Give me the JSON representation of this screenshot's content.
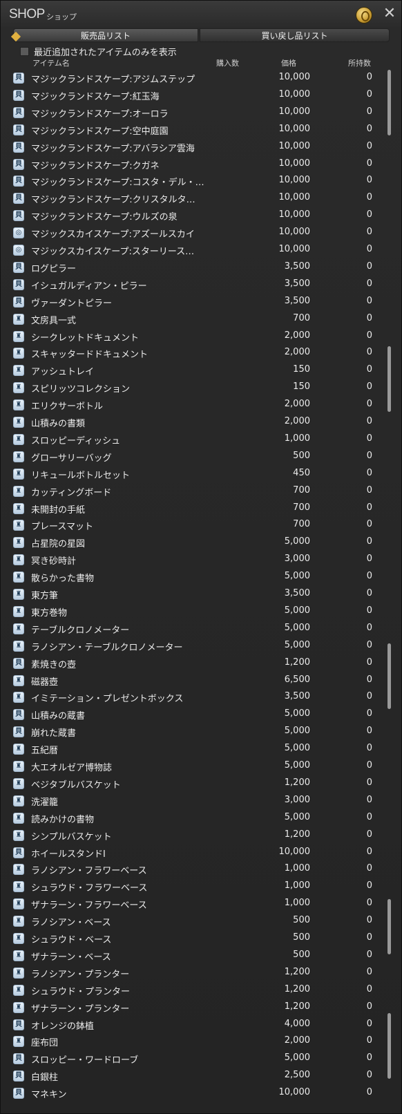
{
  "window": {
    "title": "SHOP",
    "subtitle": "ショップ",
    "gil_icon": "gil-coin-icon",
    "close_icon": "close-icon"
  },
  "tabs": [
    {
      "label": "販売品リスト"
    },
    {
      "label": "買い戻し品リスト"
    }
  ],
  "filter": {
    "label": "最近追加されたアイテムのみを表示"
  },
  "columns": {
    "name": "アイテム名",
    "qty": "購入数",
    "price": "価格",
    "owned": "所持数"
  },
  "items": [
    {
      "name": "マジックランドスケープ:アジムステップ",
      "price": "10,000",
      "owned": "0",
      "icon": "scroll-icon"
    },
    {
      "name": "マジックランドスケープ:紅玉海",
      "price": "10,000",
      "owned": "0",
      "icon": "scroll-icon"
    },
    {
      "name": "マジックランドスケープ:オーロラ",
      "price": "10,000",
      "owned": "0",
      "icon": "scroll-icon"
    },
    {
      "name": "マジックランドスケープ:空中庭園",
      "price": "10,000",
      "owned": "0",
      "icon": "scroll-icon"
    },
    {
      "name": "マジックランドスケープ:アバラシア雲海",
      "price": "10,000",
      "owned": "0",
      "icon": "scroll-icon"
    },
    {
      "name": "マジックランドスケープ:クガネ",
      "price": "10,000",
      "owned": "0",
      "icon": "scroll-icon"
    },
    {
      "name": "マジックランドスケープ:コスタ・デル・…",
      "price": "10,000",
      "owned": "0",
      "icon": "scroll-icon"
    },
    {
      "name": "マジックランドスケープ:クリスタルタ…",
      "price": "10,000",
      "owned": "0",
      "icon": "scroll-icon"
    },
    {
      "name": "マジックランドスケープ:ウルズの泉",
      "price": "10,000",
      "owned": "0",
      "icon": "scroll-icon"
    },
    {
      "name": "マジックスカイスケープ:アズールスカイ",
      "price": "10,000",
      "owned": "0",
      "icon": "sky-icon"
    },
    {
      "name": "マジックスカイスケープ:スターリース…",
      "price": "10,000",
      "owned": "0",
      "icon": "sky-icon"
    },
    {
      "name": "ログピラー",
      "price": "3,500",
      "owned": "0",
      "icon": "scroll-icon"
    },
    {
      "name": "イシュガルディアン・ピラー",
      "price": "3,500",
      "owned": "0",
      "icon": "scroll-icon"
    },
    {
      "name": "ヴァーダントピラー",
      "price": "3,500",
      "owned": "0",
      "icon": "scroll-icon"
    },
    {
      "name": "文房具一式",
      "price": "700",
      "owned": "0",
      "icon": "furnishing-icon"
    },
    {
      "name": "シークレットドキュメント",
      "price": "2,000",
      "owned": "0",
      "icon": "furnishing-icon"
    },
    {
      "name": "スキャッタードドキュメント",
      "price": "2,000",
      "owned": "0",
      "icon": "furnishing-icon"
    },
    {
      "name": "アッシュトレイ",
      "price": "150",
      "owned": "0",
      "icon": "furnishing-icon"
    },
    {
      "name": "スピリッツコレクション",
      "price": "150",
      "owned": "0",
      "icon": "furnishing-icon"
    },
    {
      "name": "エリクサーボトル",
      "price": "2,000",
      "owned": "0",
      "icon": "furnishing-icon"
    },
    {
      "name": "山積みの書類",
      "price": "2,000",
      "owned": "0",
      "icon": "furnishing-icon"
    },
    {
      "name": "スロッピーディッシュ",
      "price": "1,000",
      "owned": "0",
      "icon": "furnishing-icon"
    },
    {
      "name": "グローサリーバッグ",
      "price": "500",
      "owned": "0",
      "icon": "furnishing-icon"
    },
    {
      "name": "リキュールボトルセット",
      "price": "450",
      "owned": "0",
      "icon": "furnishing-icon"
    },
    {
      "name": "カッティングボード",
      "price": "700",
      "owned": "0",
      "icon": "furnishing-icon"
    },
    {
      "name": "未開封の手紙",
      "price": "700",
      "owned": "0",
      "icon": "furnishing-icon"
    },
    {
      "name": "プレースマット",
      "price": "700",
      "owned": "0",
      "icon": "furnishing-icon"
    },
    {
      "name": "占星院の星図",
      "price": "5,000",
      "owned": "0",
      "icon": "furnishing-icon"
    },
    {
      "name": "冥き砂時計",
      "price": "3,000",
      "owned": "0",
      "icon": "furnishing-icon"
    },
    {
      "name": "散らかった書物",
      "price": "5,000",
      "owned": "0",
      "icon": "furnishing-icon"
    },
    {
      "name": "東方筆",
      "price": "3,500",
      "owned": "0",
      "icon": "furnishing-icon"
    },
    {
      "name": "東方巻物",
      "price": "5,000",
      "owned": "0",
      "icon": "furnishing-icon"
    },
    {
      "name": "テーブルクロノメーター",
      "price": "5,000",
      "owned": "0",
      "icon": "furnishing-icon"
    },
    {
      "name": "ラノシアン・テーブルクロノメーター",
      "price": "5,000",
      "owned": "0",
      "icon": "furnishing-icon"
    },
    {
      "name": "素焼きの壺",
      "price": "1,200",
      "owned": "0",
      "icon": "scroll-icon"
    },
    {
      "name": "磁器壺",
      "price": "6,500",
      "owned": "0",
      "icon": "furnishing-icon"
    },
    {
      "name": "イミテーション・プレゼントボックス",
      "price": "3,500",
      "owned": "0",
      "icon": "furnishing-icon"
    },
    {
      "name": "山積みの蔵書",
      "price": "5,000",
      "owned": "0",
      "icon": "scroll-icon"
    },
    {
      "name": "崩れた蔵書",
      "price": "5,000",
      "owned": "0",
      "icon": "scroll-icon"
    },
    {
      "name": "五紀暦",
      "price": "5,000",
      "owned": "0",
      "icon": "furnishing-icon"
    },
    {
      "name": "大エオルゼア博物誌",
      "price": "5,000",
      "owned": "0",
      "icon": "furnishing-icon"
    },
    {
      "name": "ベジタブルバスケット",
      "price": "1,200",
      "owned": "0",
      "icon": "furnishing-icon"
    },
    {
      "name": "洗濯籠",
      "price": "3,000",
      "owned": "0",
      "icon": "furnishing-icon"
    },
    {
      "name": "読みかけの書物",
      "price": "5,000",
      "owned": "0",
      "icon": "furnishing-icon"
    },
    {
      "name": "シンプルバスケット",
      "price": "1,200",
      "owned": "0",
      "icon": "furnishing-icon"
    },
    {
      "name": "ホイールスタンドI",
      "price": "10,000",
      "owned": "0",
      "icon": "scroll-icon"
    },
    {
      "name": "ラノシアン・フラワーベース",
      "price": "1,000",
      "owned": "0",
      "icon": "furnishing-icon"
    },
    {
      "name": "シュラウド・フラワーベース",
      "price": "1,000",
      "owned": "0",
      "icon": "furnishing-icon"
    },
    {
      "name": "ザナラーン・フラワーベース",
      "price": "1,000",
      "owned": "0",
      "icon": "furnishing-icon"
    },
    {
      "name": "ラノシアン・ベース",
      "price": "500",
      "owned": "0",
      "icon": "furnishing-icon"
    },
    {
      "name": "シュラウド・ベース",
      "price": "500",
      "owned": "0",
      "icon": "furnishing-icon"
    },
    {
      "name": "ザナラーン・ベース",
      "price": "500",
      "owned": "0",
      "icon": "furnishing-icon"
    },
    {
      "name": "ラノシアン・プランター",
      "price": "1,200",
      "owned": "0",
      "icon": "furnishing-icon"
    },
    {
      "name": "シュラウド・プランター",
      "price": "1,200",
      "owned": "0",
      "icon": "furnishing-icon"
    },
    {
      "name": "ザナラーン・プランター",
      "price": "1,200",
      "owned": "0",
      "icon": "furnishing-icon"
    },
    {
      "name": "オレンジの鉢植",
      "price": "4,000",
      "owned": "0",
      "icon": "scroll-icon"
    },
    {
      "name": "座布団",
      "price": "2,000",
      "owned": "0",
      "icon": "furnishing-icon"
    },
    {
      "name": "スロッピー・ワードローブ",
      "price": "5,000",
      "owned": "0",
      "icon": "scroll-icon"
    },
    {
      "name": "白銀柱",
      "price": "2,500",
      "owned": "0",
      "icon": "scroll-icon"
    },
    {
      "name": "マネキン",
      "price": "10,000",
      "owned": "0",
      "icon": "scroll-icon"
    }
  ]
}
